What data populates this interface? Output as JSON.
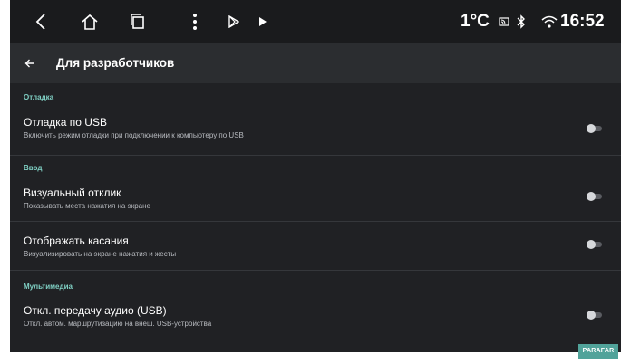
{
  "status_bar": {
    "temperature": "1°C",
    "time": "16:52",
    "icons": [
      "back-arrow-icon",
      "home-icon",
      "recent-apps-icon",
      "more-vert-icon",
      "play-store-icon",
      "play-icon",
      "cast-icon",
      "bluetooth-icon",
      "wifi-icon"
    ]
  },
  "app_bar": {
    "title": "Для разработчиков",
    "back_icon": "arrow-left-icon"
  },
  "sections": {
    "debug": "Отладка",
    "input": "Ввод",
    "multimedia": "Мультимедиа"
  },
  "settings": [
    {
      "title": "Отладка по USB",
      "summary": "Включить режим отладки при подключении к компьютеру по USB",
      "enabled": false
    },
    {
      "title": "Визуальный отклик",
      "summary": "Показывать места нажатия на экране",
      "enabled": false
    },
    {
      "title": "Отображать касания",
      "summary": "Визуализировать на экране нажатия и жесты",
      "enabled": false
    },
    {
      "title": "Откл. передачу аудио (USB)",
      "summary": "Откл. автом. маршрутизацию на внеш. USB-устройства",
      "enabled": false
    }
  ],
  "badge": "PARAFAR",
  "colors": {
    "background": "#202124",
    "status_bar": "#1a1b1d",
    "app_bar": "#2b2d30",
    "section_accent": "#7fd0c4",
    "badge": "#51a39a"
  }
}
